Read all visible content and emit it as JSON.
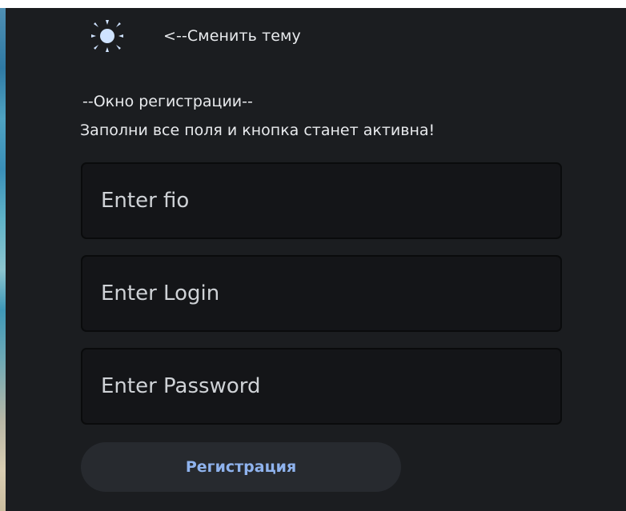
{
  "theme": {
    "icon": "sun-icon",
    "label": "<--Сменить тему"
  },
  "form": {
    "heading": "--Окно регистрации--",
    "hint": "Заполни все поля и кнопка станет активна!",
    "fields": {
      "fio_placeholder": "Enter fio",
      "login_placeholder": "Enter Login",
      "password_placeholder": "Enter Password"
    },
    "register_label": "Регистрация",
    "register_enabled": false
  },
  "colors": {
    "background": "#1b1d20",
    "field_background": "#141518",
    "button_background": "#272a2f",
    "button_text": "#8fb3ee",
    "text": "#e8eaed"
  }
}
